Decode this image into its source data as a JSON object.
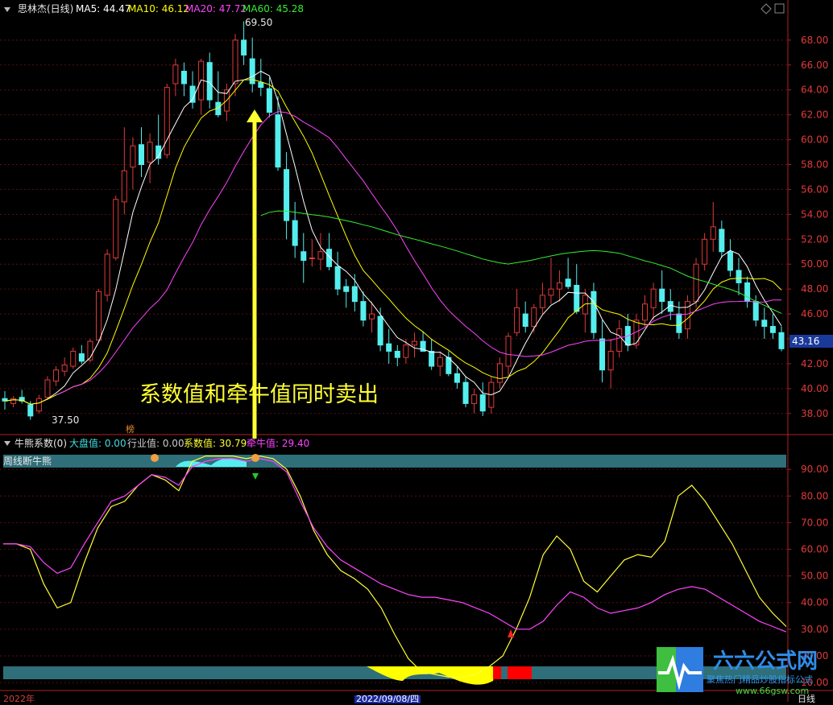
{
  "main_panel": {
    "stock_name": "思林杰(日线)",
    "ma5": "MA5: 44.47",
    "ma10": "MA10: 46.12",
    "ma20": "MA20: 47.72",
    "ma60": "MA60: 45.28",
    "high_label": "69.50",
    "low_label": "37.50",
    "last_price": "43.16",
    "rank_badge": "榜",
    "annotation": "系数值和牵牛值同时卖出",
    "colors": {
      "ma5": "#ffffff",
      "ma10": "#ffff00",
      "ma20": "#ff44ff",
      "ma60": "#33ee33",
      "up": "#e03a3a",
      "down": "#55eeee"
    }
  },
  "sub_panel": {
    "indicator_name": "牛熊系数(0)",
    "market_value": "大盘值: 0.00",
    "industry_value": "行业值: 0.00",
    "coef_value": "系数值: 30.79",
    "bull_value": "牵牛值: 29.40",
    "bar_label": "周线断牛熊"
  },
  "bottom_axis": {
    "first_label": "2022年",
    "date_highlight": "2022/09/08/四",
    "last_label": "日线"
  },
  "watermark": {
    "brand": "六六公式网",
    "tagline": "聚焦热门精品炒股指标公式",
    "url": "www.66gsw.com"
  },
  "chart_data": [
    {
      "type": "candlestick",
      "title": "思林杰(日线)",
      "y_ticks": [
        "68.00",
        "66.00",
        "64.00",
        "62.00",
        "60.00",
        "58.00",
        "56.00",
        "54.00",
        "52.00",
        "50.00",
        "48.00",
        "46.00",
        "44.00",
        "42.00",
        "40.00",
        "38.00"
      ],
      "ylim": [
        36.5,
        69.8
      ],
      "candles": [
        [
          39.2,
          39.8,
          38.3,
          39.0
        ],
        [
          38.8,
          39.4,
          38.5,
          39.2
        ],
        [
          39.3,
          39.9,
          38.8,
          39.0
        ],
        [
          38.7,
          39.0,
          37.5,
          37.8
        ],
        [
          38.2,
          39.5,
          38.0,
          39.2
        ],
        [
          39.3,
          41.0,
          39.1,
          40.7
        ],
        [
          40.6,
          41.8,
          40.2,
          41.5
        ],
        [
          41.4,
          42.5,
          41.0,
          41.9
        ],
        [
          41.8,
          43.3,
          41.6,
          43.0
        ],
        [
          42.8,
          43.5,
          42.0,
          42.2
        ],
        [
          42.3,
          44.0,
          42.1,
          43.8
        ],
        [
          43.9,
          48.0,
          43.7,
          47.8
        ],
        [
          47.5,
          51.2,
          47.0,
          50.8
        ],
        [
          50.5,
          55.5,
          50.3,
          55.2
        ],
        [
          55.0,
          61.0,
          54.0,
          57.5
        ],
        [
          57.8,
          60.2,
          56.0,
          59.5
        ],
        [
          59.6,
          61.0,
          57.0,
          58.0
        ],
        [
          58.2,
          60.5,
          56.5,
          59.8
        ],
        [
          59.5,
          62.0,
          58.0,
          58.5
        ],
        [
          58.8,
          64.5,
          58.5,
          64.2
        ],
        [
          64.5,
          66.5,
          63.5,
          66.0
        ],
        [
          65.5,
          66.2,
          63.5,
          64.5
        ],
        [
          64.3,
          65.5,
          62.5,
          63.0
        ],
        [
          63.2,
          66.5,
          62.0,
          66.3
        ],
        [
          66.2,
          67.0,
          62.5,
          63.2
        ],
        [
          63.0,
          65.5,
          61.8,
          62.0
        ],
        [
          62.3,
          64.5,
          61.5,
          64.0
        ],
        [
          64.5,
          68.5,
          63.5,
          68.0
        ],
        [
          68.0,
          69.5,
          66.0,
          66.8
        ],
        [
          66.5,
          68.2,
          63.8,
          64.5
        ],
        [
          64.6,
          66.5,
          63.5,
          64.2
        ],
        [
          64.1,
          65.0,
          61.8,
          62.2
        ],
        [
          62.0,
          63.5,
          57.5,
          57.8
        ],
        [
          57.6,
          59.0,
          52.0,
          53.5
        ],
        [
          53.5,
          55.0,
          50.5,
          51.5
        ],
        [
          51.0,
          52.5,
          48.5,
          50.3
        ],
        [
          50.5,
          52.0,
          49.8,
          50.5
        ],
        [
          50.4,
          52.5,
          49.5,
          51.0
        ],
        [
          51.2,
          52.5,
          49.5,
          49.8
        ],
        [
          49.8,
          51.0,
          47.5,
          48.0
        ],
        [
          48.2,
          48.8,
          46.5,
          47.8
        ],
        [
          48.2,
          49.2,
          46.2,
          47.0
        ],
        [
          47.0,
          47.8,
          45.0,
          45.5
        ],
        [
          45.6,
          47.0,
          44.5,
          46.0
        ],
        [
          45.8,
          46.5,
          43.0,
          43.5
        ],
        [
          43.6,
          44.8,
          42.0,
          43.0
        ],
        [
          43.0,
          43.5,
          41.8,
          42.5
        ],
        [
          42.5,
          44.0,
          42.0,
          43.5
        ],
        [
          43.5,
          44.5,
          42.5,
          43.8
        ],
        [
          43.8,
          44.6,
          43.2,
          43.0
        ],
        [
          43.0,
          44.0,
          41.5,
          41.8
        ],
        [
          41.8,
          43.0,
          41.0,
          42.5
        ],
        [
          42.5,
          43.0,
          41.0,
          41.2
        ],
        [
          41.2,
          41.8,
          40.0,
          40.5
        ],
        [
          40.5,
          41.0,
          38.5,
          38.8
        ],
        [
          38.8,
          40.0,
          38.0,
          39.5
        ],
        [
          39.5,
          40.5,
          37.8,
          38.2
        ],
        [
          38.5,
          41.0,
          38.0,
          40.5
        ],
        [
          40.5,
          42.5,
          40.0,
          42.0
        ],
        [
          41.8,
          44.5,
          41.0,
          44.2
        ],
        [
          44.5,
          48.0,
          44.2,
          46.5
        ],
        [
          46.0,
          47.0,
          44.5,
          45.0
        ],
        [
          45.0,
          46.8,
          44.5,
          46.5
        ],
        [
          46.5,
          48.5,
          46.0,
          47.5
        ],
        [
          47.5,
          50.5,
          46.8,
          48.0
        ],
        [
          48.0,
          49.5,
          47.0,
          48.5
        ],
        [
          48.8,
          50.5,
          48.0,
          48.2
        ],
        [
          48.3,
          50.0,
          46.0,
          46.2
        ],
        [
          46.0,
          48.0,
          44.5,
          47.5
        ],
        [
          47.8,
          48.5,
          44.0,
          44.5
        ],
        [
          44.0,
          45.5,
          40.5,
          41.5
        ],
        [
          41.5,
          44.0,
          40.0,
          43.0
        ],
        [
          43.0,
          45.5,
          42.5,
          44.8
        ],
        [
          45.0,
          46.0,
          43.0,
          43.5
        ],
        [
          43.5,
          46.0,
          43.2,
          45.5
        ],
        [
          45.5,
          47.5,
          45.0,
          46.8
        ],
        [
          46.5,
          48.5,
          45.5,
          48.0
        ],
        [
          48.0,
          49.5,
          46.0,
          47.0
        ],
        [
          47.0,
          48.0,
          45.5,
          46.2
        ],
        [
          46.0,
          47.0,
          44.0,
          44.5
        ],
        [
          44.8,
          47.5,
          44.0,
          47.0
        ],
        [
          47.0,
          50.5,
          46.5,
          50.0
        ],
        [
          50.0,
          52.5,
          49.5,
          52.0
        ],
        [
          52.0,
          55.0,
          51.0,
          53.0
        ],
        [
          52.8,
          53.5,
          50.5,
          51.0
        ],
        [
          51.0,
          52.0,
          49.0,
          49.5
        ],
        [
          49.5,
          50.5,
          47.5,
          48.5
        ],
        [
          48.5,
          49.0,
          46.5,
          47.0
        ],
        [
          47.0,
          47.5,
          45.0,
          45.5
        ],
        [
          45.5,
          46.5,
          44.0,
          45.0
        ],
        [
          45.0,
          46.0,
          44.0,
          44.5
        ],
        [
          44.5,
          45.0,
          43.0,
          43.2
        ]
      ]
    },
    {
      "type": "line",
      "title": "牛熊系数(0)",
      "y_ticks": [
        "90.00",
        "80.00",
        "70.00",
        "60.00",
        "50.00",
        "40.00",
        "30.00",
        "20.00",
        "10.00"
      ],
      "ylim": [
        7,
        97
      ],
      "series": [
        {
          "name": "系数值",
          "values": [
            62,
            62,
            60,
            47,
            38,
            40,
            55,
            68,
            76,
            78,
            84,
            88,
            86,
            82,
            93,
            95,
            95,
            95,
            94,
            95,
            94,
            90,
            80,
            67,
            58,
            52,
            49,
            45,
            38,
            28,
            19,
            14,
            13,
            12,
            12,
            13,
            16,
            20,
            30,
            42,
            58,
            65,
            60,
            48,
            44,
            50,
            56,
            58,
            57,
            63,
            80,
            84,
            78,
            70,
            62,
            52,
            42,
            36,
            31
          ],
          "color": "#ffff33"
        },
        {
          "name": "牵牛值",
          "values": [
            62,
            62,
            61,
            55,
            51,
            53,
            62,
            70,
            78,
            80,
            84,
            88,
            87,
            84,
            91,
            93,
            94,
            94,
            93,
            94,
            93,
            89,
            78,
            68,
            61,
            56,
            53,
            50,
            47,
            45,
            43,
            42,
            42,
            41,
            40,
            38,
            36,
            33,
            30,
            30,
            33,
            39,
            44,
            42,
            38,
            36,
            37,
            38,
            40,
            43,
            45,
            46,
            45,
            42,
            39,
            36,
            33,
            31,
            29
          ],
          "color": "#ff44ff"
        }
      ]
    }
  ]
}
